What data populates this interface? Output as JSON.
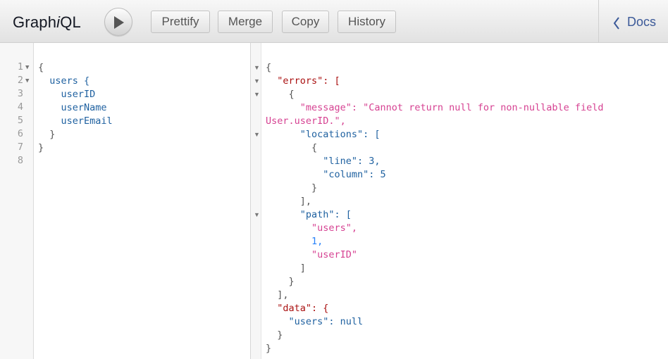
{
  "topbar": {
    "logo_pre": "Graph",
    "logo_i": "i",
    "logo_post": "QL",
    "buttons": [
      "Prettify",
      "Merge",
      "Copy",
      "History"
    ],
    "docs_label": "Docs"
  },
  "query_editor": {
    "line_numbers": [
      "1",
      "2",
      "3",
      "4",
      "5",
      "6",
      "7",
      "8"
    ],
    "lines": [
      "{",
      "  users {",
      "    userID",
      "    userName",
      "    userEmail",
      "  }",
      "}",
      ""
    ]
  },
  "result": {
    "lines": [
      "{",
      "  \"errors\": [",
      "    {",
      "      \"message\": \"Cannot return null for non-nullable field",
      "User.userID.\",",
      "      \"locations\": [",
      "        {",
      "          \"line\": 3,",
      "          \"column\": 5",
      "        }",
      "      ],",
      "      \"path\": [",
      "        \"users\",",
      "        1,",
      "        \"userID\"",
      "      ]",
      "    }",
      "  ],",
      "  \"data\": {",
      "    \"users\": null",
      "  }",
      "}"
    ]
  }
}
